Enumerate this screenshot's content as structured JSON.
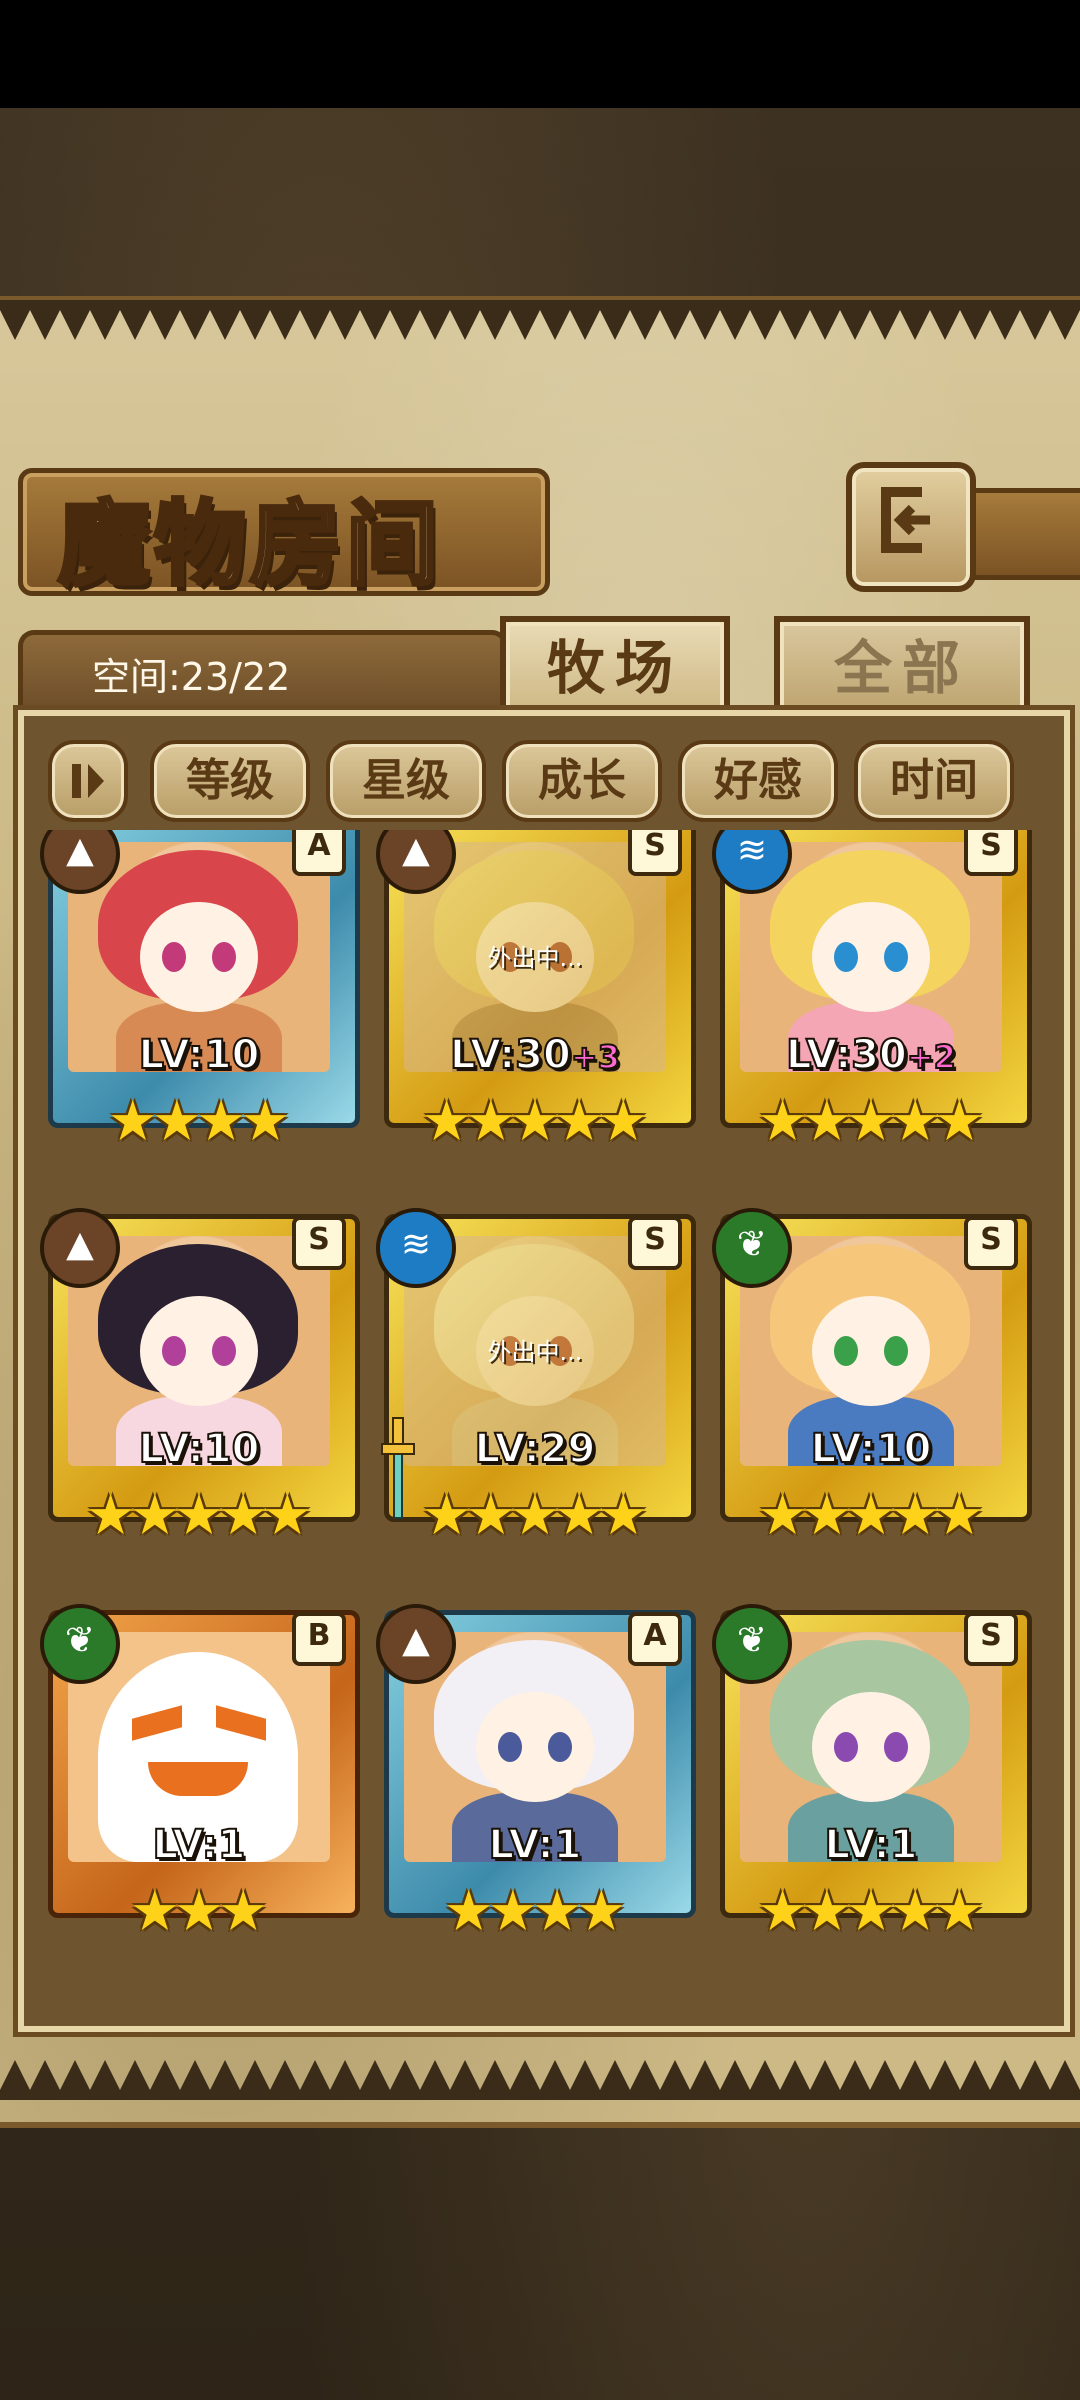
{
  "header": {
    "title": "魔物房间"
  },
  "space": {
    "label": "空间:23/22"
  },
  "tabs": [
    {
      "label": "牧场",
      "active": true
    },
    {
      "label": "全部",
      "active": false
    }
  ],
  "filters": [
    {
      "label": "等级"
    },
    {
      "label": "星级"
    },
    {
      "label": "成长"
    },
    {
      "label": "好感"
    },
    {
      "label": "时间"
    }
  ],
  "away_label": "外出中...",
  "monsters": [
    {
      "element": "earth-icon",
      "rank": "A",
      "frame": "blue",
      "level": "LV:10",
      "bonus": "",
      "stars": 4,
      "away": false,
      "hair": "#d8454a",
      "eyes": "#c23a7a",
      "body": "#d88a55"
    },
    {
      "element": "earth-icon",
      "rank": "S",
      "frame": "gold",
      "level": "LV:30",
      "bonus": "+3",
      "stars": 5,
      "away": true,
      "hair": "#f0d06a",
      "eyes": "#c04040",
      "body": "#b88a5a"
    },
    {
      "element": "water-icon",
      "rank": "S",
      "frame": "gold",
      "level": "LV:30",
      "bonus": "+2",
      "stars": 5,
      "away": false,
      "hair": "#f4d35e",
      "eyes": "#2a8fd0",
      "body": "#f4a6b4"
    },
    {
      "element": "earth-icon",
      "rank": "S",
      "frame": "gold",
      "level": "LV:10",
      "bonus": "",
      "stars": 5,
      "away": false,
      "hair": "#2a2030",
      "eyes": "#b0409a",
      "body": "#f8d8e0"
    },
    {
      "element": "water-icon",
      "rank": "S",
      "frame": "gold",
      "level": "LV:29",
      "bonus": "",
      "stars": 5,
      "away": true,
      "hair": "#f2e2b8",
      "eyes": "#d04a4a",
      "body": "#e0c8a0"
    },
    {
      "element": "wood-icon",
      "rank": "S",
      "frame": "gold",
      "level": "LV:10",
      "bonus": "",
      "stars": 5,
      "away": false,
      "hair": "#f6c67a",
      "eyes": "#3aa04a",
      "body": "#4a7ac0"
    },
    {
      "element": "wood-icon",
      "rank": "B",
      "frame": "orange",
      "level": "LV:1",
      "bonus": "",
      "stars": 3,
      "away": false,
      "ghost": true
    },
    {
      "element": "earth-icon",
      "rank": "A",
      "frame": "blue",
      "level": "LV:1",
      "bonus": "",
      "stars": 4,
      "away": false,
      "hair": "#f2f0f4",
      "eyes": "#4a5a9a",
      "body": "#5a6a9a"
    },
    {
      "element": "wood-icon",
      "rank": "S",
      "frame": "gold",
      "level": "LV:1",
      "bonus": "",
      "stars": 5,
      "away": false,
      "hair": "#a8c6a0",
      "eyes": "#8a4ab0",
      "body": "#6aa0a0"
    }
  ],
  "colors": {
    "parchment": "#cdb986",
    "gold_frame": "#f3d640",
    "blue_frame": "#3d8bab",
    "star": "#ffd21a",
    "bonus": "#ff6ad0"
  }
}
